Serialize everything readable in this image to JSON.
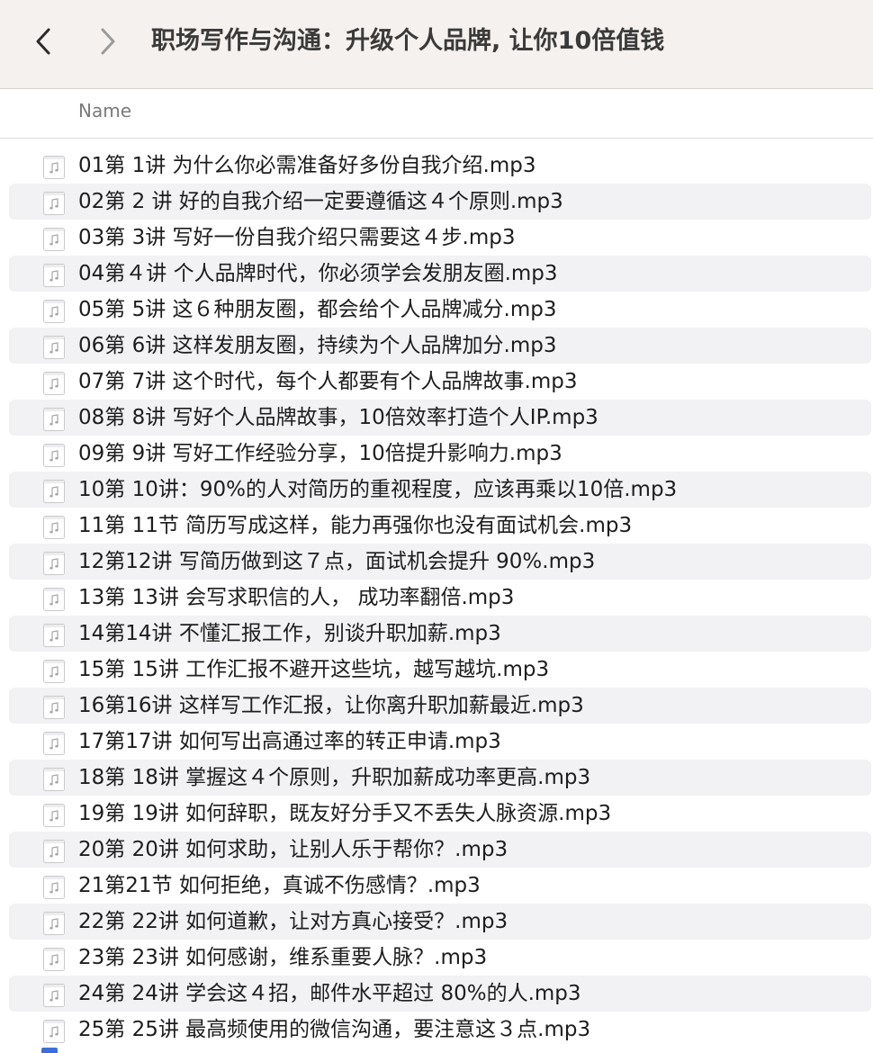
{
  "window": {
    "title": "职场写作与沟通：升级个人品牌, 让你10倍值钱"
  },
  "toolbar": {
    "back_icon": "chevron-left-icon",
    "forward_icon": "chevron-right-icon"
  },
  "columns": {
    "name": "Name"
  },
  "files": [
    "01第 1讲 为什么你必需准备好多份自我介绍.mp3",
    "02第 2 讲 好的自我介绍一定要遵循这４个原则.mp3",
    "03第 3讲 写好一份自我介绍只需要这４步.mp3",
    "04第４讲 个人品牌时代，你必须学会发朋友圈.mp3",
    "05第 5讲 这６种朋友圈，都会给个人品牌减分.mp3",
    "06第 6讲 这样发朋友圈，持续为个人品牌加分.mp3",
    "07第 7讲 这个时代，每个人都要有个人品牌故事.mp3",
    "08第 8讲 写好个人品牌故事，10倍效率打造个人IP.mp3",
    "09第 9讲 写好工作经验分享，10倍提升影响力.mp3",
    "10第 10讲：90%的人对简历的重视程度，应该再乘以10倍.mp3",
    "11第 11节 简历写成这样，能力再强你也没有面试机会.mp3",
    "12第12讲 写简历做到这７点，面试机会提升 90%.mp3",
    "13第 13讲 会写求职信的人， 成功率翻倍.mp3",
    "14第14讲 不懂汇报工作，别谈升职加薪.mp3",
    "15第 15讲 工作汇报不避开这些坑，越写越坑.mp3",
    "16第16讲 这样写工作汇报，让你离升职加薪最近.mp3",
    "17第17讲 如何写出高通过率的转正申请.mp3",
    "18第 18讲 掌握这４个原则，升职加薪成功率更高.mp3",
    "19第 19讲 如何辞职，既友好分手又不丢失人脉资源.mp3",
    "20第 20讲 如何求助，让别人乐于帮你？.mp3",
    "21第21节 如何拒绝，真诚不伤感情？.mp3",
    "22第 22讲 如何道歉，让对方真心接受？.mp3",
    "23第 23讲 如何感谢，维系重要人脉？.mp3",
    "24第 24讲 学会这４招，邮件水平超过 80%的人.mp3",
    "25第 25讲 最高频使用的微信沟通，要注意这３点.mp3"
  ],
  "colors": {
    "toolbar_bg": "#f5f1ee",
    "row_alt_bg": "#f2f2f4",
    "selection_marker": "#3b6fd8"
  }
}
